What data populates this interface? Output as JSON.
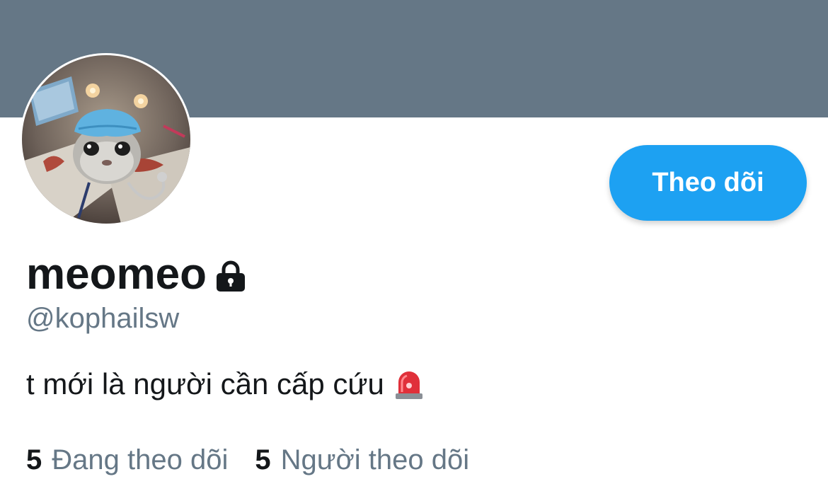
{
  "profile": {
    "display_name": "meomeo",
    "handle": "@kophailsw",
    "bio": "t mới là người cần cấp cứu",
    "locked": true
  },
  "actions": {
    "follow_label": "Theo dõi"
  },
  "stats": {
    "following_count": "5",
    "following_label": "Đang theo dõi",
    "followers_count": "5",
    "followers_label": "Người theo dõi"
  },
  "icons": {
    "lock": "lock-icon",
    "siren": "police-car-light-icon"
  },
  "colors": {
    "banner": "#657786",
    "accent": "#1DA1F2",
    "text_primary": "#14171A",
    "text_secondary": "#657786"
  }
}
